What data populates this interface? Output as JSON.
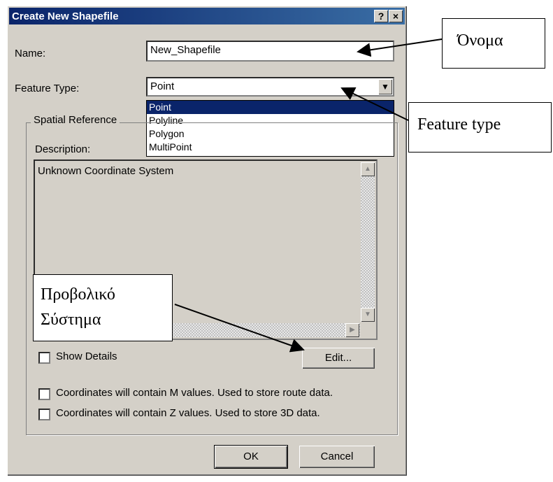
{
  "dialog": {
    "title": "Create New Shapefile",
    "help_button": "?",
    "close_button": "×"
  },
  "name": {
    "label": "Name:",
    "value": "New_Shapefile"
  },
  "feature_type": {
    "label": "Feature Type:",
    "value": "Point",
    "options": [
      "Point",
      "Polyline",
      "Polygon",
      "MultiPoint"
    ],
    "selected_index": 0
  },
  "spatial_reference": {
    "group_label": "Spatial Reference",
    "description_label": "Description:",
    "description_text": "Unknown Coordinate System",
    "show_details_label": "Show Details",
    "edit_button": "Edit..."
  },
  "options": {
    "m_values": "Coordinates will contain M values. Used to store route data.",
    "z_values": "Coordinates will contain Z values. Used to store 3D data."
  },
  "buttons": {
    "ok": "OK",
    "cancel": "Cancel"
  },
  "annotations": {
    "name_callout": "Όνομα",
    "feature_type_callout": "Feature type",
    "projection_callout_line1": "Προβολικό",
    "projection_callout_line2": "Σύστημα"
  },
  "colors": {
    "titlebar": "#0a246a",
    "dialog_bg": "#d4d0c8",
    "selection": "#0a246a"
  }
}
